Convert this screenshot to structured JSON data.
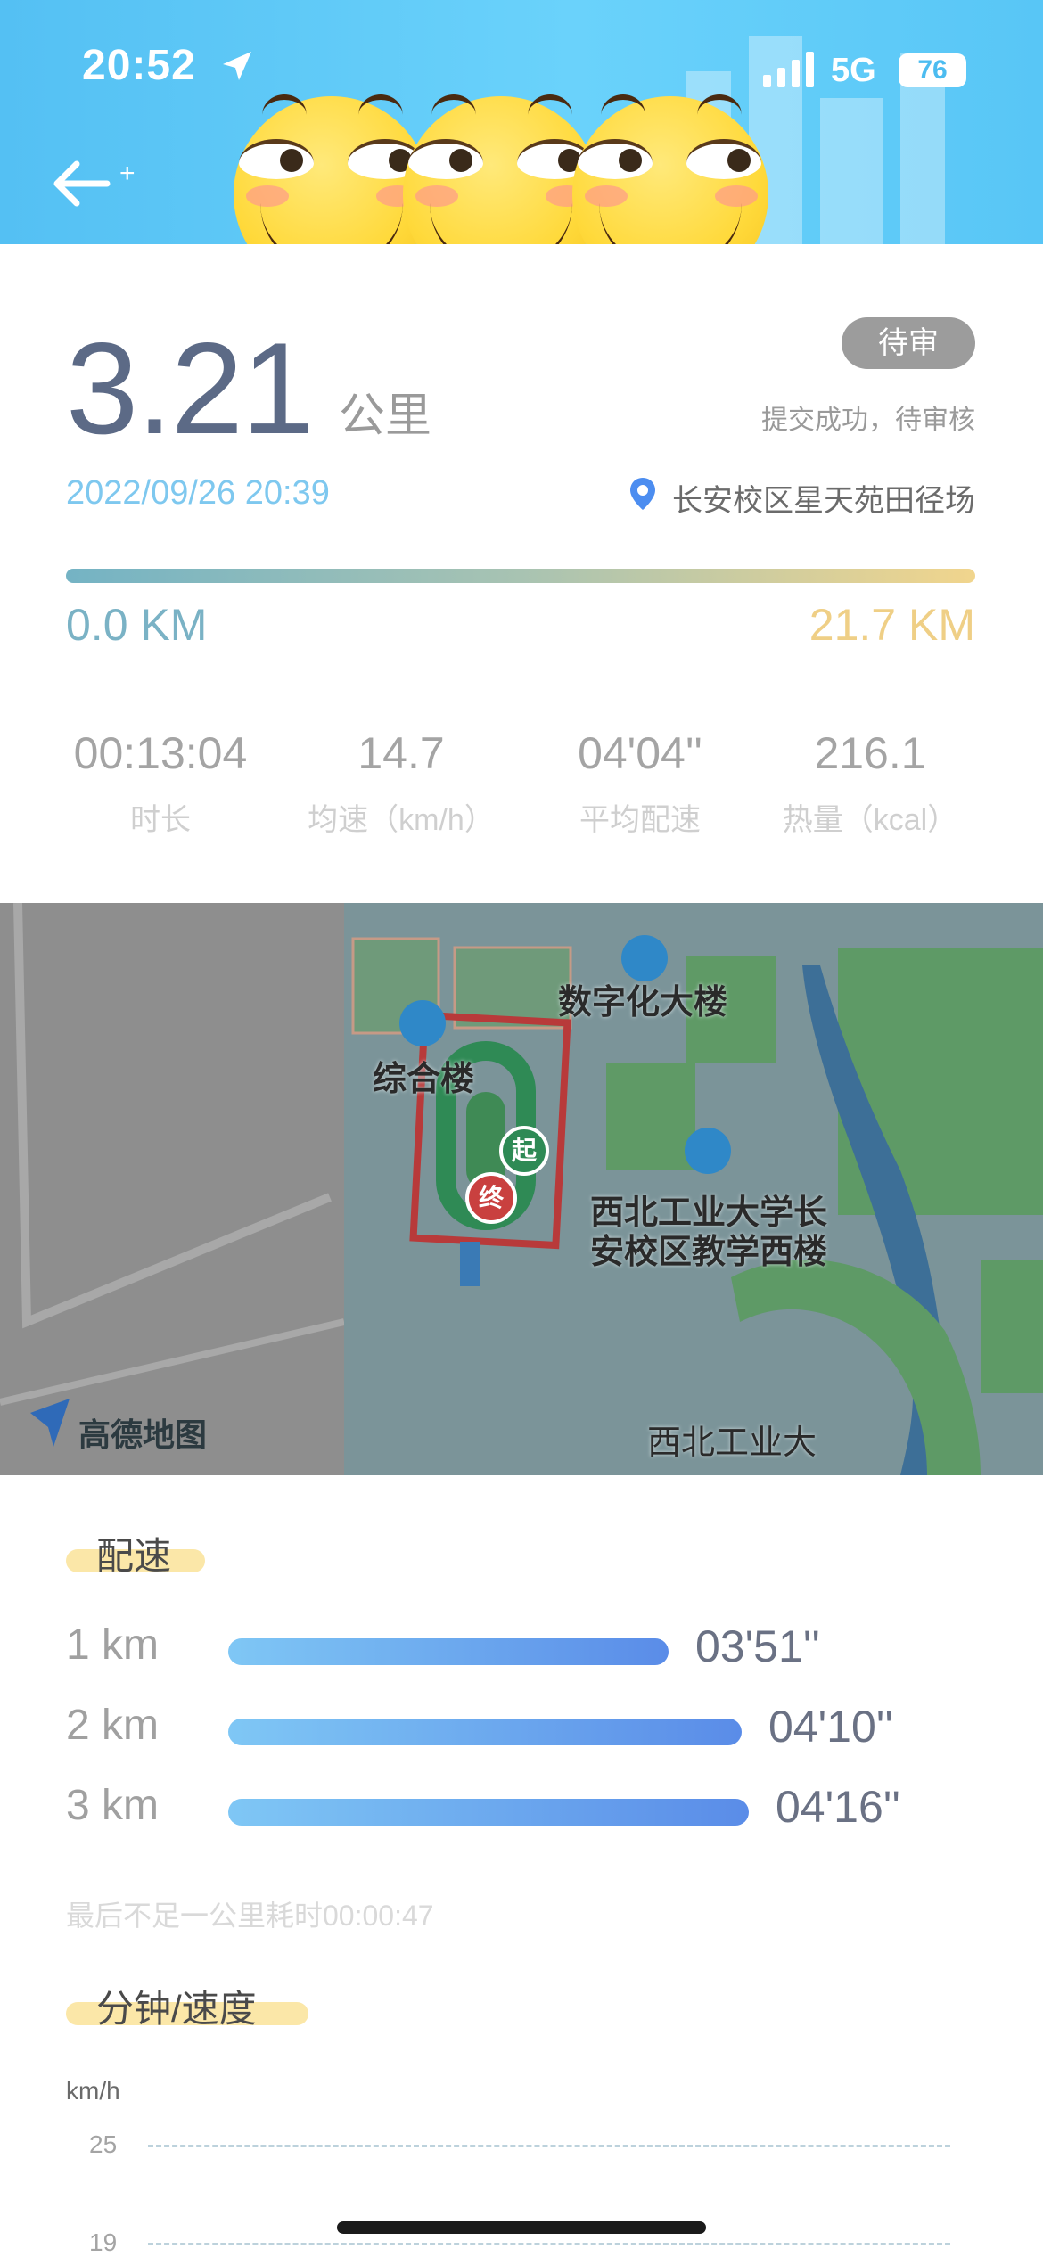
{
  "status_bar": {
    "time": "20:52",
    "network": "5G",
    "battery": "76"
  },
  "summary": {
    "distance": "3.21",
    "distance_unit": "公里",
    "status_badge": "待审",
    "status_text": "提交成功，待审核",
    "datetime": "2022/09/26 20:39",
    "location": "长安校区星天苑田径场",
    "range_min": "0.0 KM",
    "range_max": "21.7 KM"
  },
  "stats": [
    {
      "value": "00:13:04",
      "label": "时长"
    },
    {
      "value": "14.7",
      "label": "均速（km/h）"
    },
    {
      "value": "04'04''",
      "label": "平均配速"
    },
    {
      "value": "216.1",
      "label": "热量（kcal）"
    }
  ],
  "map": {
    "labels": {
      "digital_building": "数字化大楼",
      "complex_building": "综合楼",
      "teaching_building": "西北工业大学长\n安校区教学西楼",
      "university": "西北工业大"
    },
    "start_marker": "起",
    "end_marker": "终",
    "provider": "高德地图"
  },
  "pace": {
    "title": "配速",
    "rows": [
      {
        "km": "1 km",
        "pace": "03'51''",
        "fraction": 0.6
      },
      {
        "km": "2 km",
        "pace": "04'10''",
        "fraction": 0.7
      },
      {
        "km": "3 km",
        "pace": "04'16''",
        "fraction": 0.71
      }
    ],
    "note": "最后不足一公里耗时00:00:47"
  },
  "speed_chart": {
    "title": "分钟/速度",
    "unit": "km/h",
    "ticks": [
      "25",
      "19"
    ]
  },
  "colors": {
    "header": "#54c0f3",
    "accent_blue": "#5a8ce8",
    "range_start": "#74b3c4",
    "range_end": "#f1d58d",
    "badge": "#9c9c9c"
  }
}
